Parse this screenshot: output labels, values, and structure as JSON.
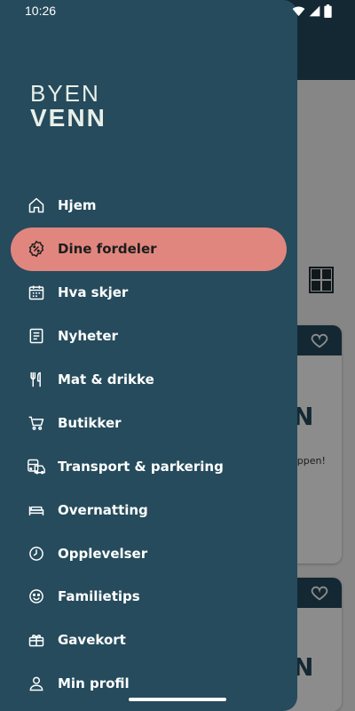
{
  "status_bar": {
    "time": "10:26"
  },
  "brand": {
    "line1": "BYEN",
    "line2": "VENN"
  },
  "menu": {
    "items": [
      {
        "label": "Hjem",
        "icon": "home-icon",
        "active": false
      },
      {
        "label": "Dine fordeler",
        "icon": "discount-badge-icon",
        "active": true
      },
      {
        "label": "Hva skjer",
        "icon": "calendar-icon",
        "active": false
      },
      {
        "label": "Nyheter",
        "icon": "document-icon",
        "active": false
      },
      {
        "label": "Mat & drikke",
        "icon": "fork-knife-icon",
        "active": false
      },
      {
        "label": "Butikker",
        "icon": "shopping-cart-icon",
        "active": false
      },
      {
        "label": "Transport & parkering",
        "icon": "vehicles-icon",
        "active": false
      },
      {
        "label": "Overnatting",
        "icon": "bed-icon",
        "active": false
      },
      {
        "label": "Opplevelser",
        "icon": "clock-icon",
        "active": false
      },
      {
        "label": "Familietips",
        "icon": "smiley-icon",
        "active": false
      },
      {
        "label": "Gavekort",
        "icon": "gift-card-icon",
        "active": false
      },
      {
        "label": "Min profil",
        "icon": "person-icon",
        "active": false
      }
    ]
  },
  "background": {
    "card_logo_fragment": "N",
    "card_text_fragment": "appen!"
  },
  "colors": {
    "drawer": "#254b5c",
    "active_item": "#e1867e",
    "text_light": "#ffffff"
  }
}
